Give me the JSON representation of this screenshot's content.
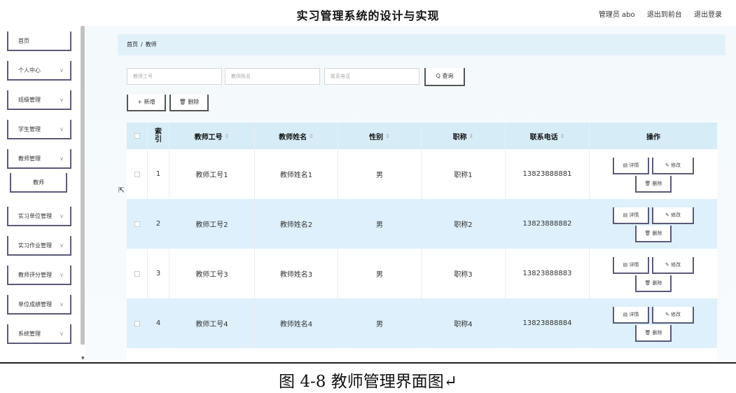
{
  "header": {
    "title": "实习管理系统的设计与实现",
    "admin": "管理员 abo",
    "back_front": "退出到前台",
    "logout": "退出登录"
  },
  "sidebar": {
    "items": [
      {
        "label": "首页",
        "chevron": ""
      },
      {
        "label": "个人中心",
        "chevron": "∨"
      },
      {
        "label": "班级管理",
        "chevron": "∨"
      },
      {
        "label": "学生管理",
        "chevron": "∨"
      },
      {
        "label": "教师管理",
        "chevron": "∨"
      },
      {
        "label": "教师",
        "chevron": ""
      },
      {
        "label": "实习单位管理",
        "chevron": "∨"
      },
      {
        "label": "实习作业管理",
        "chevron": "∨"
      },
      {
        "label": "教师评分管理",
        "chevron": "∨"
      },
      {
        "label": "单位成绩管理",
        "chevron": "∨"
      },
      {
        "label": "系统管理",
        "chevron": "∨"
      }
    ]
  },
  "breadcrumb": {
    "home": "首页",
    "sep": "/",
    "current": "教师"
  },
  "search": {
    "teacher_no": "教师工号",
    "teacher_name": "教师姓名",
    "phone": "联系电话",
    "query": "Q 查询"
  },
  "actions": {
    "add": "+ 新增",
    "delete": "🗑 删除"
  },
  "table": {
    "headers": {
      "idx_top": "索",
      "idx_bottom": "引",
      "no": "教师工号",
      "name": "教师姓名",
      "sex": "性别",
      "title": "职称",
      "phone": "联系电话",
      "op": "操作",
      "sort": "⇕"
    },
    "op_labels": {
      "detail": "▤ 详情",
      "edit": "✎ 修改",
      "delete": "🗑 删除"
    },
    "rows": [
      {
        "idx": "1",
        "no": "教师工号1",
        "name": "教师姓名1",
        "sex": "男",
        "title": "职称1",
        "phone": "13823888881"
      },
      {
        "idx": "2",
        "no": "教师工号2",
        "name": "教师姓名2",
        "sex": "男",
        "title": "职称2",
        "phone": "13823888882"
      },
      {
        "idx": "3",
        "no": "教师工号3",
        "name": "教师姓名3",
        "sex": "男",
        "title": "职称3",
        "phone": "13823888883"
      },
      {
        "idx": "4",
        "no": "教师工号4",
        "name": "教师姓名4",
        "sex": "男",
        "title": "职称4",
        "phone": "13823888884"
      }
    ]
  },
  "caption": "图 4-8 教师管理界面图↵",
  "colors": {
    "accent_blue": "#d6edf8",
    "row_alt": "#ddf0fb",
    "button_border": "#5a5a7a"
  }
}
